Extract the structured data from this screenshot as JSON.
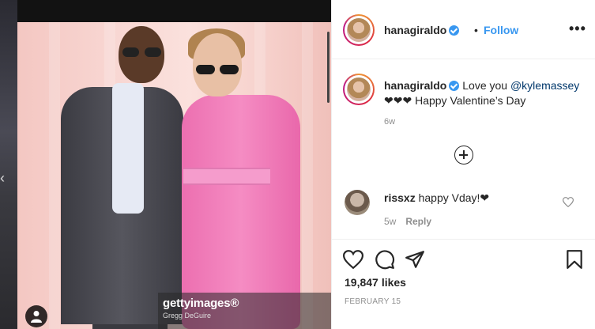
{
  "post": {
    "author": "hanagiraldo",
    "separator": "•",
    "follow_label": "Follow",
    "more_label": "•••"
  },
  "caption": {
    "author": "hanagiraldo",
    "text_before_mention": "Love you ",
    "mention": "@kylemassey",
    "line2": "❤❤❤ Happy Valentine’s Day",
    "time": "6w"
  },
  "comment": {
    "author": "rissxz",
    "text": "happy Vday!❤",
    "time": "5w",
    "reply_label": "Reply"
  },
  "media": {
    "watermark_brand": "gettyimages®",
    "watermark_credit": "Gregg DeGuire"
  },
  "engagement": {
    "likes_count": "19,847",
    "likes_word": "likes",
    "date": "FEBRUARY 15"
  },
  "colors": {
    "accent": "#3897f0",
    "suit_pink": "#f58cc3",
    "backdrop_pink": "#f8d6d2"
  }
}
